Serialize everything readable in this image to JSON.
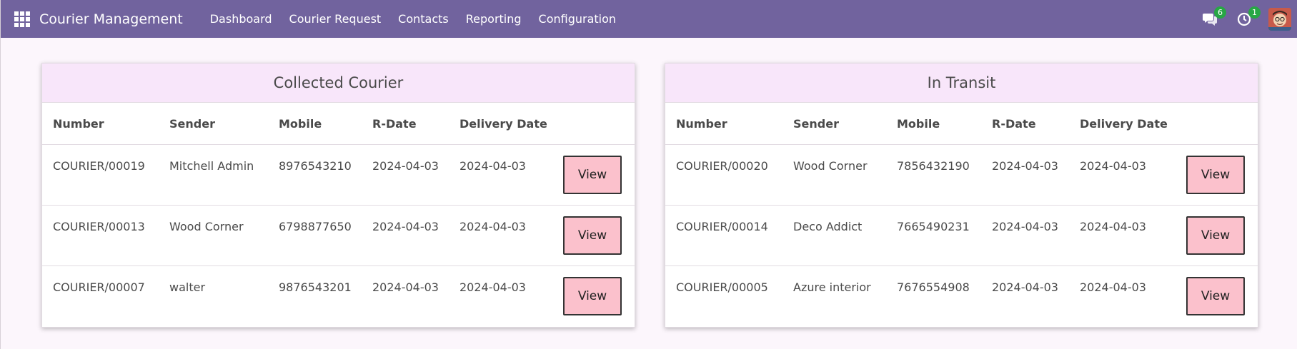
{
  "navbar": {
    "brand": "Courier Management",
    "menu": [
      "Dashboard",
      "Courier Request",
      "Contacts",
      "Reporting",
      "Configuration"
    ],
    "messages_badge": "6",
    "activity_badge": "1",
    "icons": [
      "apps-grid-icon",
      "chat-icon",
      "clock-icon",
      "avatar"
    ]
  },
  "colors": {
    "navbar": "#71639e",
    "card_header": "#f8e6fa",
    "view_button": "#fbc1cc",
    "badge": "#28a745"
  },
  "tables": [
    {
      "title": "Collected Courier",
      "columns": [
        "Number",
        "Sender",
        "Mobile",
        "R-Date",
        "Delivery Date"
      ],
      "rows": [
        {
          "number": "COURIER/00019",
          "sender": "Mitchell Admin",
          "mobile": "8976543210",
          "rdate": "2024-04-03",
          "delivery": "2024-04-03",
          "action": "View"
        },
        {
          "number": "COURIER/00013",
          "sender": "Wood Corner",
          "mobile": "6798877650",
          "rdate": "2024-04-03",
          "delivery": "2024-04-03",
          "action": "View"
        },
        {
          "number": "COURIER/00007",
          "sender": "walter",
          "mobile": "9876543201",
          "rdate": "2024-04-03",
          "delivery": "2024-04-03",
          "action": "View"
        }
      ]
    },
    {
      "title": "In Transit",
      "columns": [
        "Number",
        "Sender",
        "Mobile",
        "R-Date",
        "Delivery Date"
      ],
      "rows": [
        {
          "number": "COURIER/00020",
          "sender": "Wood Corner",
          "mobile": "7856432190",
          "rdate": "2024-04-03",
          "delivery": "2024-04-03",
          "action": "View"
        },
        {
          "number": "COURIER/00014",
          "sender": "Deco Addict",
          "mobile": "7665490231",
          "rdate": "2024-04-03",
          "delivery": "2024-04-03",
          "action": "View"
        },
        {
          "number": "COURIER/00005",
          "sender": "Azure interior",
          "mobile": "7676554908",
          "rdate": "2024-04-03",
          "delivery": "2024-04-03",
          "action": "View"
        }
      ]
    }
  ]
}
